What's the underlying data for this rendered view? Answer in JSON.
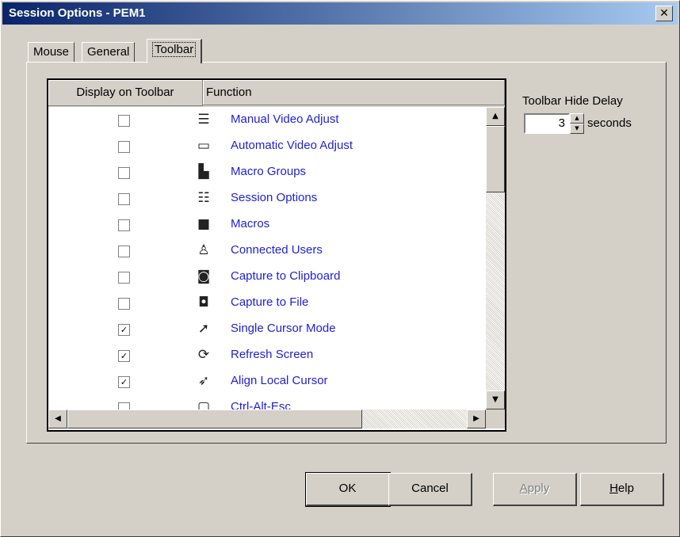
{
  "window": {
    "title": "Session Options - PEM1",
    "close_glyph": "✕"
  },
  "tabs": [
    {
      "label": "Mouse",
      "active": false
    },
    {
      "label": "General",
      "active": false
    },
    {
      "label": "Toolbar",
      "active": true
    }
  ],
  "table": {
    "columns": [
      "Display on Toolbar",
      "Function"
    ],
    "rows": [
      {
        "checked": false,
        "icon": "manual-video-adjust-icon",
        "glyph": "☰",
        "label": "Manual Video Adjust"
      },
      {
        "checked": false,
        "icon": "automatic-video-adjust-icon",
        "glyph": "▭",
        "label": "Automatic Video Adjust"
      },
      {
        "checked": false,
        "icon": "macro-groups-icon",
        "glyph": "▙",
        "label": "Macro Groups"
      },
      {
        "checked": false,
        "icon": "session-options-icon",
        "glyph": "☷",
        "label": "Session Options"
      },
      {
        "checked": false,
        "icon": "macros-icon",
        "glyph": "■",
        "label": "Macros"
      },
      {
        "checked": false,
        "icon": "connected-users-icon",
        "glyph": "♙",
        "label": "Connected Users"
      },
      {
        "checked": false,
        "icon": "capture-to-clipboard-icon",
        "glyph": "◙",
        "label": "Capture to Clipboard"
      },
      {
        "checked": false,
        "icon": "capture-to-file-icon",
        "glyph": "◘",
        "label": "Capture to File"
      },
      {
        "checked": true,
        "icon": "single-cursor-mode-icon",
        "glyph": "➚",
        "label": "Single Cursor Mode"
      },
      {
        "checked": true,
        "icon": "refresh-screen-icon",
        "glyph": "⟳",
        "label": "Refresh Screen"
      },
      {
        "checked": true,
        "icon": "align-local-cursor-icon",
        "glyph": "➶",
        "label": "Align Local Cursor"
      },
      {
        "checked": false,
        "icon": "partial-row-icon",
        "glyph": "▢",
        "label": "Ctrl-Alt-Esc"
      }
    ],
    "check_glyph": "✓"
  },
  "scroll_glyphs": {
    "up": "▲",
    "down": "▼",
    "left": "◀",
    "right": "▶"
  },
  "toolbar_hide_delay": {
    "label": "Toolbar Hide Delay",
    "value": "3",
    "unit": "seconds"
  },
  "buttons": {
    "ok": "OK",
    "cancel": "Cancel",
    "apply_first": "A",
    "apply_rest": "pply",
    "help_first": "H",
    "help_rest": "elp"
  }
}
